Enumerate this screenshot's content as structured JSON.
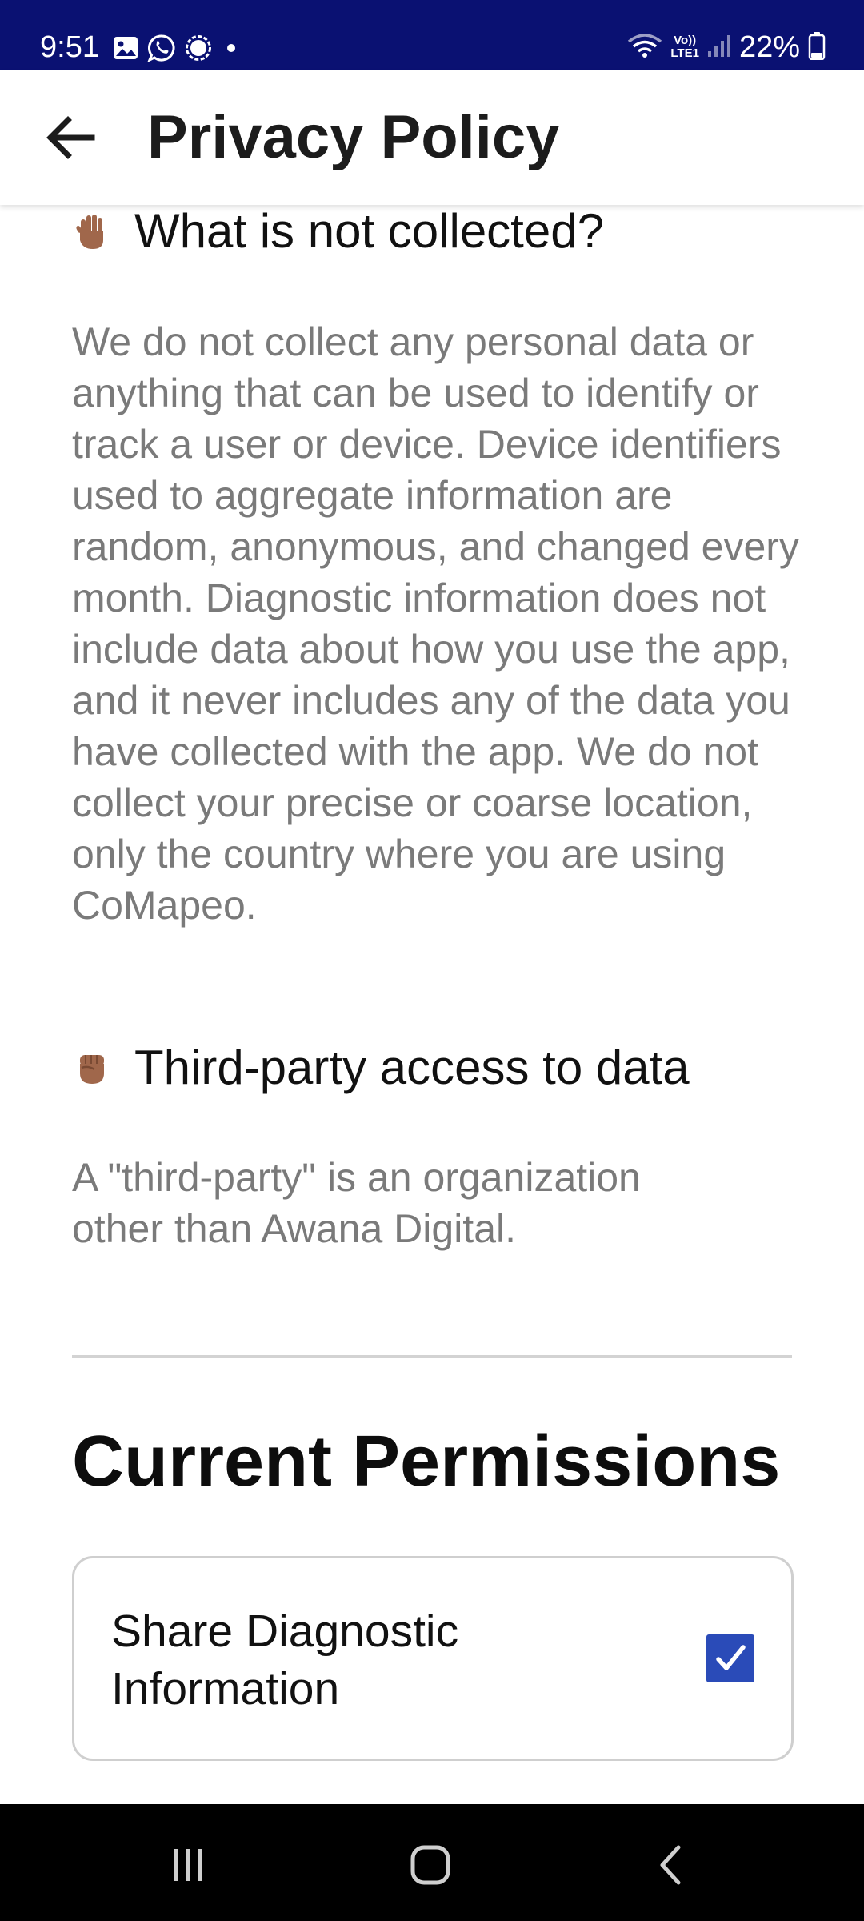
{
  "status_bar": {
    "time": "9:51",
    "battery": "22%",
    "network_label_top": "Vo))",
    "network_label_bottom": "LTE1",
    "left_icons": [
      "gallery-icon",
      "whatsapp-icon",
      "signal-messenger-icon",
      "notification-dot-icon"
    ],
    "right_icons": [
      "wifi-icon",
      "volte-icon",
      "cell-signal-icon",
      "battery-icon"
    ],
    "background_color": "#0a1172"
  },
  "app_bar": {
    "title": "Privacy Policy",
    "back_icon": "back-arrow-icon"
  },
  "sections": [
    {
      "icon": "raised-hand-emoji-icon",
      "heading": "What is not collected?",
      "body": "We do not collect any personal data or anything that can be used to identify or track a user or device. Device identifiers used to aggregate information are random, anonymous, and changed every month. Diagnostic information does not include data about how you use the app, and it never includes any of the data you have collected with the app. We do not collect your precise or coarse location, only the country where you are using CoMapeo."
    },
    {
      "icon": "raised-fist-emoji-icon",
      "heading": "Third-party access to data",
      "body": "A \"third-party\" is an organization other than Awana Digital."
    }
  ],
  "permissions": {
    "title": "Current Permissions",
    "items": [
      {
        "label": "Share Diagnostic Information",
        "checked": true
      }
    ],
    "checkbox_color": "#2a4bb8"
  },
  "nav_bar": {
    "icons": [
      "recent-apps-icon",
      "home-icon",
      "back-nav-icon"
    ]
  }
}
